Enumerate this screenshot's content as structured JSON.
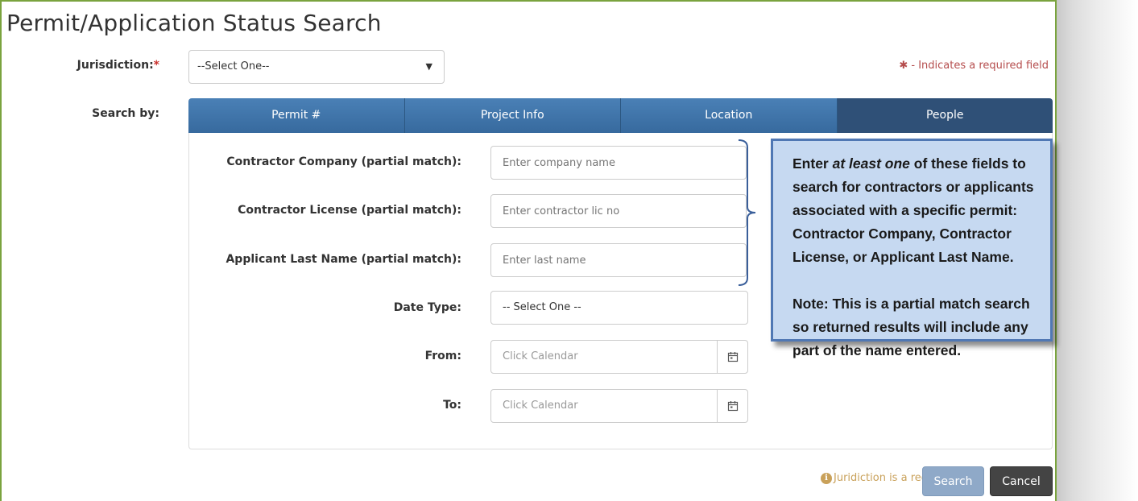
{
  "page": {
    "title": "Permit/Application Status Search"
  },
  "jurisdiction": {
    "label": "Jurisdiction:",
    "required_mark": "*",
    "selected": "--Select One--"
  },
  "required_note": {
    "symbol": "✱",
    "text": " - Indicates a required field"
  },
  "search_by": {
    "label": "Search by:",
    "tabs": [
      {
        "label": "Permit #",
        "active": false
      },
      {
        "label": "Project Info",
        "active": false
      },
      {
        "label": "Location",
        "active": false
      },
      {
        "label": "People",
        "active": true
      }
    ]
  },
  "form": {
    "contractor_company": {
      "label": "Contractor Company (partial match):",
      "placeholder": "Enter company name"
    },
    "contractor_license": {
      "label": "Contractor License (partial match):",
      "placeholder": "Enter contractor lic no"
    },
    "applicant_last_name": {
      "label": "Applicant Last Name (partial match):",
      "placeholder": "Enter last name"
    },
    "date_type": {
      "label": "Date Type:",
      "selected": "-- Select One --"
    },
    "from": {
      "label": "From:",
      "placeholder": "Click Calendar"
    },
    "to": {
      "label": "To:",
      "placeholder": "Click Calendar"
    }
  },
  "callout": {
    "line1_pre": "Enter ",
    "line1_em": "at least one",
    "line1_post": " of these fields to",
    "line2": "search for contractors or applicants",
    "line3": "associated with a specific permit:",
    "line4": "Contractor Company, Contractor",
    "line5": "License, or Applicant Last Name.",
    "note1": "Note: This is a partial match search",
    "note2": "so returned results will include any",
    "note3": "part of the name entered."
  },
  "footer": {
    "info_icon": "i",
    "warning": "Juridiction is a required field",
    "search_label": "Search",
    "cancel_label": "Cancel"
  },
  "colors": {
    "frame_border": "#7aa33e",
    "tab": "#4a80b6",
    "tab_active": "#2f5077",
    "callout_bg": "#c6d9f1",
    "callout_border": "#5078b4",
    "required": "#c9302c",
    "warning": "#c9a15a"
  },
  "icons": {
    "calendar": "calendar-icon",
    "dropdown": "caret-down-icon",
    "info": "info-icon"
  }
}
